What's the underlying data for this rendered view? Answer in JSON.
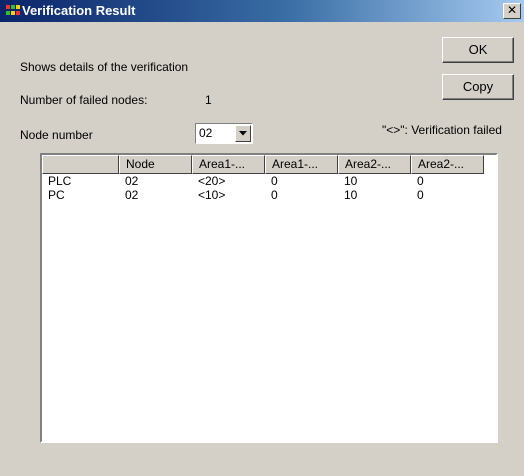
{
  "window": {
    "title": "Verification Result",
    "close_glyph": "✕"
  },
  "content": {
    "description": "Shows details of the verification",
    "failed_nodes_label": "Number of failed nodes:",
    "failed_nodes_value": "1",
    "node_number_label": "Node number",
    "node_number_selected": "02",
    "legend_note": "\"<>\": Verification failed"
  },
  "buttons": {
    "ok": "OK",
    "copy": "Copy"
  },
  "table": {
    "columns": [
      "",
      "Node",
      "Area1-...",
      "Area1-...",
      "Area2-...",
      "Area2-..."
    ],
    "rows": [
      [
        "PLC",
        "02",
        "<20>",
        "0",
        "10",
        "0"
      ],
      [
        "PC",
        "02",
        "<10>",
        "0",
        "10",
        "0"
      ]
    ]
  },
  "icons": {
    "app": "app-icon",
    "close": "close-icon",
    "dropdown": "chevron-down-icon"
  }
}
